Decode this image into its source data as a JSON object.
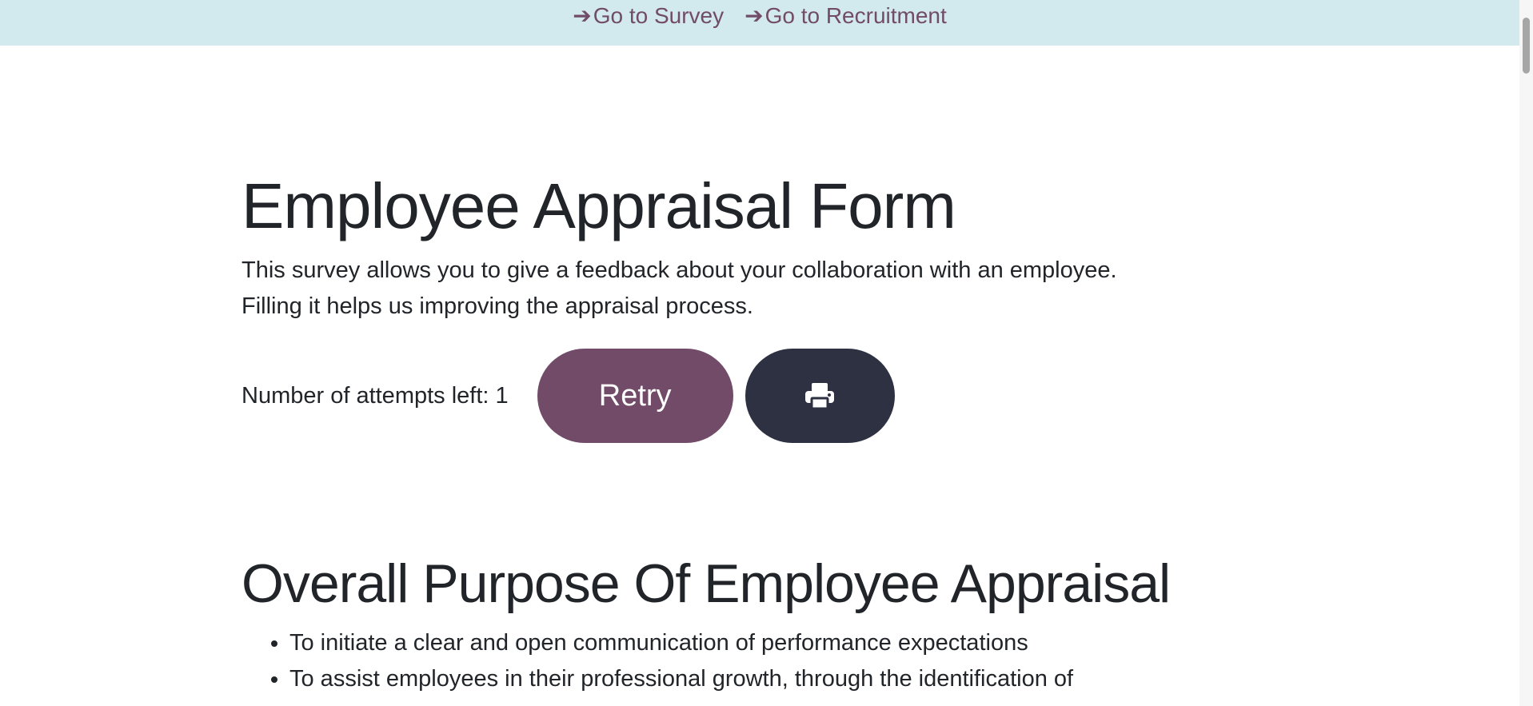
{
  "nav": {
    "links": [
      {
        "label": "Go to Survey",
        "icon": "arrow-right-icon"
      },
      {
        "label": "Go to Recruitment",
        "icon": "arrow-right-icon"
      }
    ],
    "arrow_glyph": "➔"
  },
  "survey": {
    "title": "Employee Appraisal Form",
    "description_line1": "This survey allows you to give a feedback about your collaboration with an employee.",
    "description_line2": "Filling it helps us improving the appraisal process.",
    "attempts_text": "Number of attempts left: 1",
    "retry_label": "Retry",
    "print_icon": "print-icon"
  },
  "section": {
    "heading": "Overall Purpose Of Employee Appraisal",
    "items": [
      "To initiate a clear and open communication of performance expectations",
      "To assist employees in their professional growth, through the identification of"
    ]
  },
  "colors": {
    "topbar_bg": "#d2eaee",
    "link": "#714b67",
    "retry_bg": "#714b67",
    "print_bg": "#2d3142",
    "text": "#212529"
  }
}
